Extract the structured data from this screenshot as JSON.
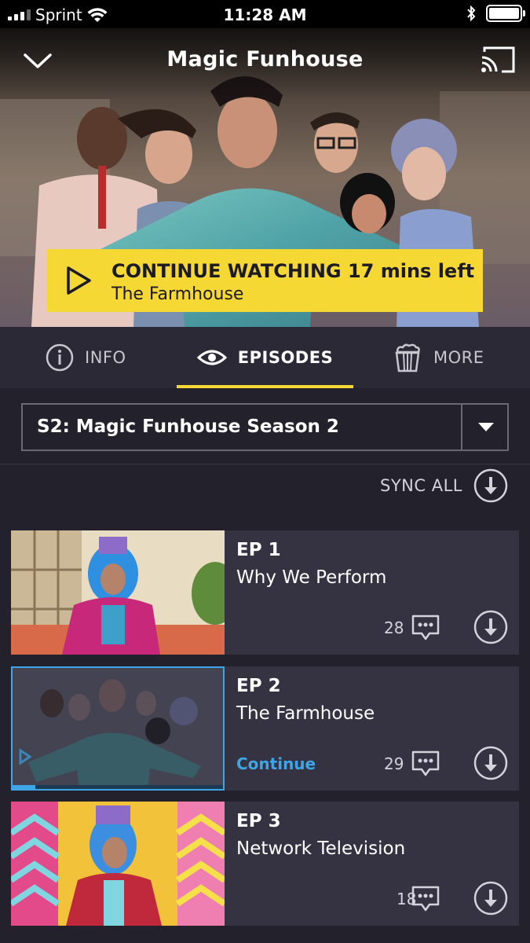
{
  "status_bar": {
    "carrier": "Sprint",
    "time": "11:28 AM",
    "battery_level": 1.0
  },
  "header": {
    "title": "Magic Funhouse",
    "collapse_icon": "chevron-down-icon",
    "cast_icon": "cast-icon"
  },
  "continue_banner": {
    "line1": "CONTINUE WATCHING 17 mins left",
    "line2": "The Farmhouse",
    "play_icon": "play-icon",
    "color": "#f5d833"
  },
  "tabs": [
    {
      "label": "INFO",
      "icon": "info-icon",
      "active": false
    },
    {
      "label": "EPISODES",
      "icon": "eye-icon",
      "active": true
    },
    {
      "label": "MORE",
      "icon": "popcorn-icon",
      "active": false
    }
  ],
  "season_select": {
    "value": "S2: Magic Funhouse Season 2"
  },
  "sync_all": {
    "label": "SYNC ALL",
    "icon": "download-icon"
  },
  "episodes": [
    {
      "number": "EP 1",
      "title": "Why We Perform",
      "comments": "28",
      "continue": "",
      "progress": 0
    },
    {
      "number": "EP 2",
      "title": "The Farmhouse",
      "comments": "29",
      "continue": "Continue",
      "progress": 0.11
    },
    {
      "number": "EP 3",
      "title": "Network Television",
      "comments": "18",
      "continue": "",
      "progress": 0
    }
  ],
  "colors": {
    "accent_yellow": "#f5d833",
    "accent_blue": "#3ea6e6",
    "background": "#23212c",
    "card": "#353342"
  }
}
